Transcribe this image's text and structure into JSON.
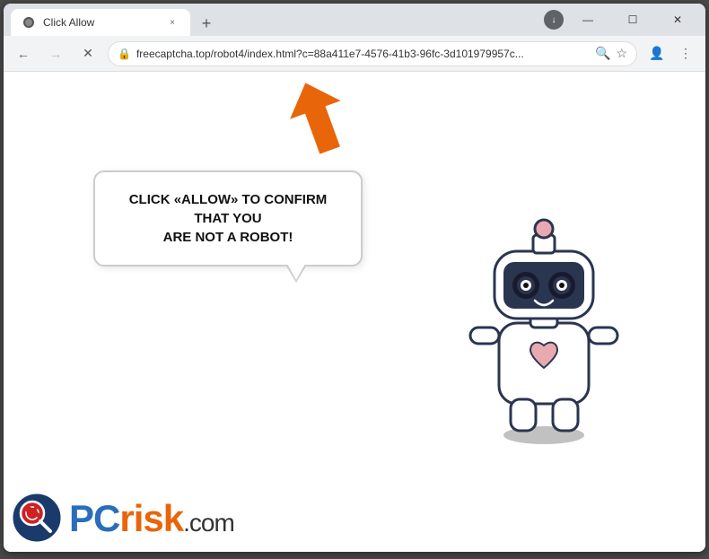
{
  "browser": {
    "tab": {
      "title": "Click Allow",
      "favicon": "page-icon"
    },
    "new_tab_label": "+",
    "window_controls": {
      "minimize": "—",
      "maximize": "☐",
      "close": "✕"
    },
    "nav": {
      "back": "←",
      "forward": "→",
      "reload": "✕",
      "url": "freecaptcha.top/robot4/index.html?c=88a411e7-4576-41b3-96fc-3d101979957c...",
      "search_icon": "🔍",
      "star_icon": "☆",
      "profile_icon": "👤",
      "menu_icon": "⋮"
    }
  },
  "page": {
    "bubble_text_line1": "CLICK «ALLOW» TO CONFIRM THAT YOU",
    "bubble_text_line2": "ARE NOT A ROBOT!",
    "arrow_direction": "up-left"
  },
  "watermark": {
    "pc": "PC",
    "risk": "risk",
    "dot_com": ".com"
  },
  "icons": {
    "lock": "🔒",
    "back": "‹",
    "forward": "›",
    "close": "×",
    "reload": "↺"
  }
}
